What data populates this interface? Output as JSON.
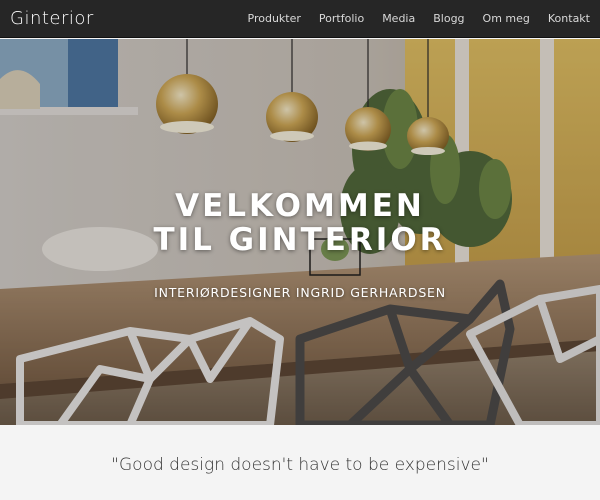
{
  "brand": {
    "name": "Ginterior"
  },
  "nav": {
    "items": [
      {
        "label": "Produkter"
      },
      {
        "label": "Portfolio"
      },
      {
        "label": "Media"
      },
      {
        "label": "Blogg"
      },
      {
        "label": "Om meg"
      },
      {
        "label": "Kontakt"
      }
    ]
  },
  "hero": {
    "title": "VELKOMMEN TIL GINTERIOR",
    "subtitle": "INTERIØRDESIGNER INGRID GERHARDSEN"
  },
  "quote": {
    "text": "\"Good design doesn't have to be expensive\""
  },
  "colors": {
    "navbar": "#262626",
    "accent_gold": "#c9a24a"
  }
}
